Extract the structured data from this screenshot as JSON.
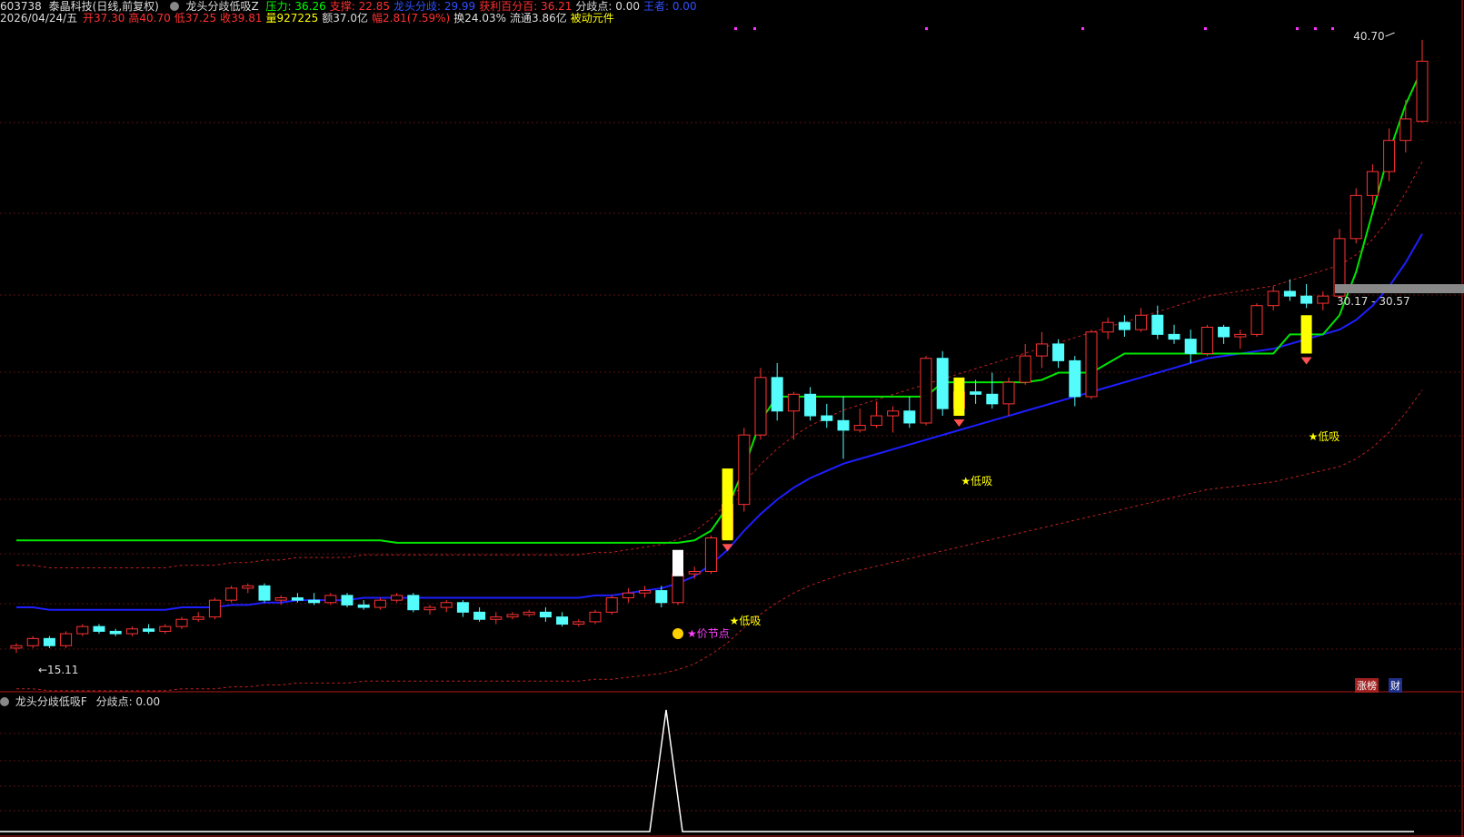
{
  "header1": {
    "code": "603738",
    "name": "泰晶科技(日线,前复权)",
    "indicator": "龙头分歧低吸Z",
    "items": [
      {
        "label": "压力: 36.26",
        "color": "#00ff00"
      },
      {
        "label": "支撑: 22.85",
        "color": "#ff3030"
      },
      {
        "label": "龙头分歧: 29.99",
        "color": "#3050ff"
      },
      {
        "label": "获利百分百: 36.21",
        "color": "#ff3030"
      },
      {
        "label": "分歧点: 0.00",
        "color": "#dddddd"
      },
      {
        "label": "王者: 0.00",
        "color": "#3050ff"
      }
    ]
  },
  "header2": {
    "date": "2026/04/24/五",
    "items": [
      {
        "label": "开37.30",
        "color": "#ff3030"
      },
      {
        "label": "高40.70",
        "color": "#ff3030"
      },
      {
        "label": "低37.25",
        "color": "#ff3030"
      },
      {
        "label": "收39.81",
        "color": "#ff3030"
      },
      {
        "label": "量927225",
        "color": "#ffff00"
      },
      {
        "label": "额37.0亿",
        "color": "#dddddd"
      },
      {
        "label": "幅2.81(7.59%)",
        "color": "#ff3030"
      },
      {
        "label": "换24.03%",
        "color": "#dddddd"
      },
      {
        "label": "流通3.86亿",
        "color": "#dddddd"
      },
      {
        "label": "被动元件",
        "color": "#ffff00"
      }
    ]
  },
  "chart_labels": {
    "high": "40.70",
    "low": "15.11",
    "range": "30.17 - 30.57",
    "signal_low": "★低吸",
    "signal_price": "价节点"
  },
  "sub_panel": {
    "title": "龙头分歧低吸F",
    "value": "分歧点: 0.00"
  },
  "badges": {
    "b1": "涨榜",
    "b2": "财"
  },
  "colors": {
    "up": "#ff3232",
    "down": "#54fcfc",
    "green_line": "#00e600",
    "blue_line": "#1e1eff",
    "signal": "#ffff00"
  },
  "chart_data": {
    "type": "candlestick",
    "high_mark": 40.7,
    "low_mark": 15.11,
    "candles": [
      [
        15.3,
        15.5,
        15.1,
        15.4
      ],
      [
        15.4,
        15.8,
        15.3,
        15.7
      ],
      [
        15.7,
        15.8,
        15.3,
        15.4
      ],
      [
        15.4,
        16.0,
        15.3,
        15.9
      ],
      [
        15.9,
        16.3,
        15.8,
        16.2
      ],
      [
        16.2,
        16.3,
        15.9,
        16.0
      ],
      [
        16.0,
        16.1,
        15.8,
        15.9
      ],
      [
        15.9,
        16.2,
        15.8,
        16.1
      ],
      [
        16.1,
        16.3,
        15.9,
        16.0
      ],
      [
        16.0,
        16.3,
        15.9,
        16.2
      ],
      [
        16.2,
        16.6,
        16.1,
        16.5
      ],
      [
        16.5,
        16.8,
        16.4,
        16.6
      ],
      [
        16.6,
        17.4,
        16.5,
        17.3
      ],
      [
        17.3,
        17.9,
        17.2,
        17.8
      ],
      [
        17.8,
        18.0,
        17.6,
        17.9
      ],
      [
        17.9,
        18.0,
        17.2,
        17.3
      ],
      [
        17.3,
        17.5,
        17.1,
        17.4
      ],
      [
        17.4,
        17.6,
        17.2,
        17.3
      ],
      [
        17.3,
        17.6,
        17.1,
        17.2
      ],
      [
        17.2,
        17.6,
        17.1,
        17.5
      ],
      [
        17.5,
        17.6,
        17.0,
        17.1
      ],
      [
        17.1,
        17.3,
        16.9,
        17.0
      ],
      [
        17.0,
        17.4,
        16.9,
        17.3
      ],
      [
        17.3,
        17.6,
        17.2,
        17.5
      ],
      [
        17.5,
        17.6,
        16.8,
        16.9
      ],
      [
        16.9,
        17.1,
        16.7,
        17.0
      ],
      [
        17.0,
        17.3,
        16.8,
        17.2
      ],
      [
        17.2,
        17.3,
        16.6,
        16.8
      ],
      [
        16.8,
        17.0,
        16.4,
        16.5
      ],
      [
        16.5,
        16.8,
        16.3,
        16.6
      ],
      [
        16.6,
        16.8,
        16.5,
        16.7
      ],
      [
        16.7,
        16.9,
        16.6,
        16.8
      ],
      [
        16.8,
        17.0,
        16.4,
        16.6
      ],
      [
        16.6,
        16.8,
        16.2,
        16.3
      ],
      [
        16.3,
        16.5,
        16.2,
        16.4
      ],
      [
        16.4,
        16.9,
        16.3,
        16.8
      ],
      [
        16.8,
        17.5,
        16.7,
        17.4
      ],
      [
        17.4,
        17.8,
        17.2,
        17.6
      ],
      [
        17.6,
        17.9,
        17.4,
        17.7
      ],
      [
        17.7,
        17.9,
        17.0,
        17.2
      ],
      [
        17.2,
        18.5,
        17.1,
        18.4
      ],
      [
        18.4,
        18.7,
        18.2,
        18.5
      ],
      [
        18.5,
        20.0,
        18.4,
        19.9
      ],
      [
        19.9,
        21.5,
        19.8,
        21.3
      ],
      [
        21.3,
        24.5,
        21.0,
        24.2
      ],
      [
        24.2,
        27.0,
        24.0,
        26.6
      ],
      [
        26.6,
        27.2,
        24.8,
        25.2
      ],
      [
        25.2,
        26.0,
        24.0,
        25.9
      ],
      [
        25.9,
        26.2,
        24.8,
        25.0
      ],
      [
        25.0,
        25.5,
        24.5,
        24.8
      ],
      [
        24.8,
        25.8,
        23.2,
        24.4
      ],
      [
        24.4,
        25.3,
        24.3,
        24.6
      ],
      [
        24.6,
        25.6,
        24.5,
        25.0
      ],
      [
        25.0,
        25.4,
        24.3,
        25.2
      ],
      [
        25.2,
        25.8,
        24.5,
        24.7
      ],
      [
        24.7,
        27.5,
        24.6,
        27.4
      ],
      [
        27.4,
        27.7,
        25.0,
        25.3
      ],
      [
        25.3,
        26.2,
        25.2,
        26.0
      ],
      [
        26.0,
        26.5,
        25.5,
        25.9
      ],
      [
        25.9,
        26.8,
        25.3,
        25.5
      ],
      [
        25.5,
        26.6,
        25.0,
        26.4
      ],
      [
        26.4,
        28.0,
        26.3,
        27.5
      ],
      [
        27.5,
        28.5,
        27.0,
        28.0
      ],
      [
        28.0,
        28.2,
        27.0,
        27.3
      ],
      [
        27.3,
        27.5,
        25.4,
        25.8
      ],
      [
        25.8,
        28.6,
        25.7,
        28.5
      ],
      [
        28.5,
        29.1,
        28.2,
        28.9
      ],
      [
        28.9,
        29.2,
        28.3,
        28.6
      ],
      [
        28.6,
        29.5,
        28.5,
        29.2
      ],
      [
        29.2,
        29.6,
        28.2,
        28.4
      ],
      [
        28.4,
        28.8,
        28.0,
        28.2
      ],
      [
        28.2,
        28.6,
        27.2,
        27.6
      ],
      [
        27.6,
        28.8,
        27.5,
        28.7
      ],
      [
        28.7,
        28.8,
        28.0,
        28.3
      ],
      [
        28.3,
        28.6,
        27.8,
        28.4
      ],
      [
        28.4,
        29.7,
        28.3,
        29.6
      ],
      [
        29.6,
        30.4,
        29.4,
        30.2
      ],
      [
        30.2,
        30.7,
        29.8,
        30.0
      ],
      [
        30.0,
        30.5,
        29.5,
        29.7
      ],
      [
        29.7,
        30.2,
        29.4,
        30.0
      ],
      [
        30.0,
        32.8,
        29.9,
        32.4
      ],
      [
        32.4,
        34.5,
        32.2,
        34.2
      ],
      [
        34.2,
        35.5,
        33.8,
        35.2
      ],
      [
        35.2,
        37.0,
        34.8,
        36.5
      ],
      [
        36.5,
        38.2,
        36.0,
        37.4
      ],
      [
        37.3,
        40.7,
        37.25,
        39.81
      ]
    ],
    "green_line": [
      19.8,
      19.8,
      19.8,
      19.8,
      19.8,
      19.8,
      19.8,
      19.8,
      19.8,
      19.8,
      19.8,
      19.8,
      19.8,
      19.8,
      19.8,
      19.8,
      19.8,
      19.8,
      19.8,
      19.8,
      19.8,
      19.8,
      19.8,
      19.7,
      19.7,
      19.7,
      19.7,
      19.7,
      19.7,
      19.7,
      19.7,
      19.7,
      19.7,
      19.7,
      19.7,
      19.7,
      19.7,
      19.7,
      19.7,
      19.7,
      19.7,
      19.8,
      20.2,
      21.2,
      22.8,
      24.8,
      25.8,
      25.8,
      25.8,
      25.8,
      25.8,
      25.8,
      25.8,
      25.8,
      25.8,
      25.8,
      26.4,
      26.4,
      26.4,
      26.4,
      26.4,
      26.4,
      26.5,
      26.8,
      26.8,
      26.8,
      27.2,
      27.6,
      27.6,
      27.6,
      27.6,
      27.6,
      27.6,
      27.6,
      27.6,
      27.6,
      27.6,
      28.4,
      28.4,
      28.4,
      29.2,
      31.0,
      33.5,
      36.0,
      38.0,
      39.5
    ],
    "blue_line": [
      17.0,
      17.0,
      16.9,
      16.9,
      16.9,
      16.9,
      16.9,
      16.9,
      16.9,
      16.9,
      17.0,
      17.0,
      17.0,
      17.1,
      17.1,
      17.2,
      17.2,
      17.3,
      17.3,
      17.3,
      17.3,
      17.4,
      17.4,
      17.4,
      17.4,
      17.4,
      17.4,
      17.4,
      17.4,
      17.4,
      17.4,
      17.4,
      17.4,
      17.4,
      17.4,
      17.5,
      17.5,
      17.6,
      17.7,
      17.8,
      18.0,
      18.3,
      18.8,
      19.4,
      20.2,
      20.9,
      21.5,
      22.0,
      22.4,
      22.7,
      23.0,
      23.2,
      23.4,
      23.6,
      23.8,
      24.0,
      24.2,
      24.4,
      24.6,
      24.8,
      25.0,
      25.2,
      25.4,
      25.6,
      25.8,
      26.0,
      26.2,
      26.4,
      26.6,
      26.8,
      27.0,
      27.2,
      27.4,
      27.5,
      27.6,
      27.7,
      27.8,
      28.0,
      28.2,
      28.4,
      28.6,
      29.0,
      29.6,
      30.4,
      31.4,
      32.6
    ]
  }
}
